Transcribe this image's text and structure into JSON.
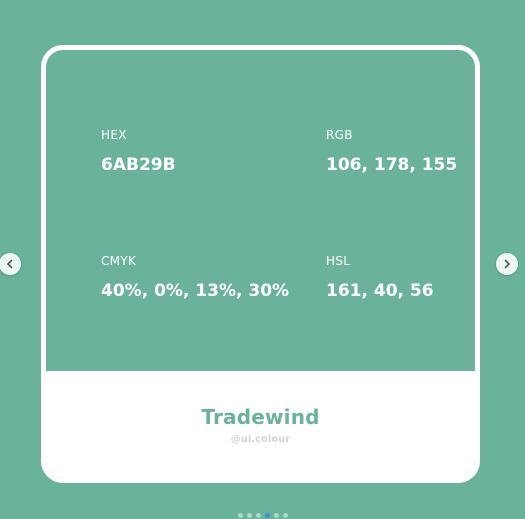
{
  "colors": {
    "background": "#6AB29B",
    "card_border": "#FFFFFF",
    "accent_name": "#6AB29B",
    "handle": "#D4D4D4",
    "active_dot": "#3C8FD9"
  },
  "fields": {
    "hex": {
      "label": "HEX",
      "value": "6AB29B"
    },
    "rgb": {
      "label": "RGB",
      "value": "106, 178, 155"
    },
    "cmyk": {
      "label": "CMYK",
      "value": "40%, 0%, 13%, 30%"
    },
    "hsl": {
      "label": "HSL",
      "value": "161, 40, 56"
    }
  },
  "footer": {
    "name": "Tradewind",
    "handle": "@ui.colour"
  },
  "carousel": {
    "prev_icon": "chevron-left-icon",
    "next_icon": "chevron-right-icon",
    "slide_count": 6,
    "active_index": 3
  }
}
